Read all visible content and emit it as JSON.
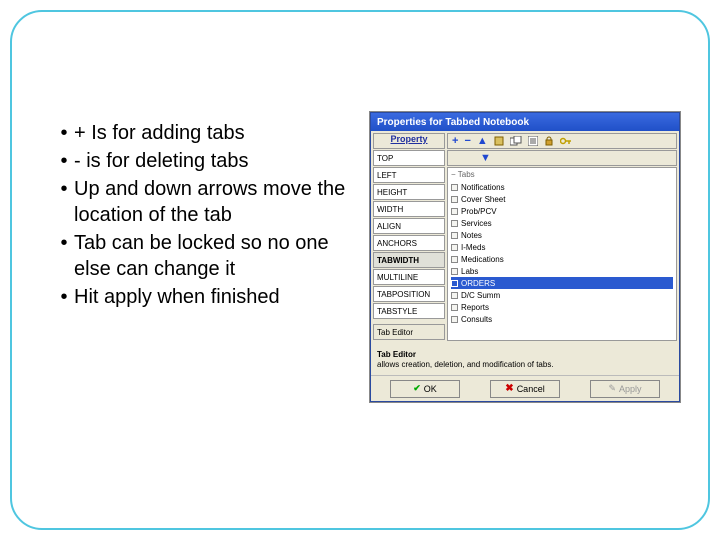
{
  "bullets": [
    "+ Is for adding tabs",
    " - is for deleting tabs",
    "Up and down arrows move the location of the tab",
    "Tab can be locked so no one else can change it",
    "Hit apply when finished"
  ],
  "dialog": {
    "title": "Properties for Tabbed Notebook",
    "property_header": "Property",
    "properties": [
      "TOP",
      "LEFT",
      "HEIGHT",
      "WIDTH",
      "ALIGN",
      "ANCHORS",
      "TABWIDTH",
      "MULTILINE",
      "TABPOSITION",
      "TABSTYLE"
    ],
    "tab_editor_btn": "Tab Editor",
    "value_label": "Tabs",
    "tabs": [
      "Notifications",
      "Cover Sheet",
      "Prob/PCV",
      "Services",
      "Notes",
      "I-Meds",
      "Medications",
      "Labs",
      "ORDERS",
      "D/C Summ",
      "Reports",
      "Consults"
    ],
    "selected_tab_index": 8,
    "help_title": "Tab Editor",
    "help_text": "allows creation, deletion, and modification of tabs.",
    "ok": "OK",
    "cancel": "Cancel",
    "apply": "Apply"
  }
}
